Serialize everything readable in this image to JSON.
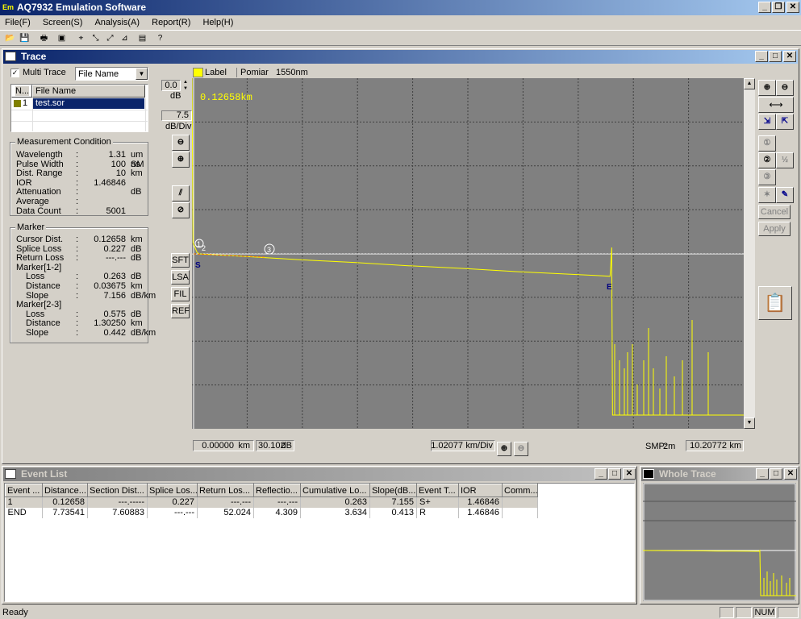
{
  "app": {
    "title": "AQ7932 Emulation Software",
    "icon_text": "Em",
    "window_buttons": {
      "minimize": "_",
      "restore": "❐",
      "close": "✕"
    }
  },
  "menu": [
    "File(F)",
    "Screen(S)",
    "Analysis(A)",
    "Report(R)",
    "Help(H)"
  ],
  "toolbar_icons": [
    "open-icon",
    "save-icon",
    "print-icon",
    "screen-icon",
    "marker-icon",
    "trace-icon",
    "analysis-icon",
    "event-icon",
    "report-icon",
    "help-icon"
  ],
  "trace": {
    "title": "Trace",
    "multi_trace_label": "Multi Trace",
    "multi_trace_checked": true,
    "file_name_select": "File Name",
    "file_table": {
      "headers": [
        "N...",
        "File Name"
      ],
      "rows": [
        {
          "n": "1",
          "name": "test.sor"
        }
      ]
    },
    "measurement": {
      "title": "Measurement Condition",
      "rows": [
        {
          "key": "Wavelength",
          "value": "1.31",
          "unit": "um SM"
        },
        {
          "key": "Pulse Width",
          "value": "100",
          "unit": "ns"
        },
        {
          "key": "Dist. Range",
          "value": "10",
          "unit": "km"
        },
        {
          "key": "IOR",
          "value": "1.46846",
          "unit": ""
        },
        {
          "key": "Attenuation",
          "value": "",
          "unit": "dB"
        },
        {
          "key": "Average",
          "value": "",
          "unit": ""
        },
        {
          "key": "Data Count",
          "value": "5001",
          "unit": ""
        }
      ]
    },
    "marker": {
      "title": "Marker",
      "rows": [
        {
          "key": "Cursor Dist.",
          "value": "0.12658",
          "unit": "km",
          "indent": false
        },
        {
          "key": "Splice Loss",
          "value": "0.227",
          "unit": "dB",
          "indent": false
        },
        {
          "key": "Return Loss",
          "value": "---.---",
          "unit": "dB",
          "indent": false
        },
        {
          "key": "Marker[1-2]",
          "value": "",
          "unit": "",
          "indent": false,
          "heading": true
        },
        {
          "key": "Loss",
          "value": "0.263",
          "unit": "dB",
          "indent": true
        },
        {
          "key": "Distance",
          "value": "0.03675",
          "unit": "km",
          "indent": true
        },
        {
          "key": "Slope",
          "value": "7.156",
          "unit": "dB/km",
          "indent": true
        },
        {
          "key": "Marker[2-3]",
          "value": "",
          "unit": "",
          "indent": false,
          "heading": true
        },
        {
          "key": "Loss",
          "value": "0.575",
          "unit": "dB",
          "indent": true
        },
        {
          "key": "Distance",
          "value": "1.30250",
          "unit": "km",
          "indent": true
        },
        {
          "key": "Slope",
          "value": "0.442",
          "unit": "dB/km",
          "indent": true
        }
      ]
    },
    "vscale": {
      "offset": "0.0",
      "offset_unit": "dB",
      "div": "7.5",
      "div_unit": "dB/Div"
    },
    "side_buttons": [
      "SFT",
      "LSA",
      "FIL",
      "REF"
    ],
    "label_bar": {
      "label": "Label",
      "text": "Pomiar   1550nm",
      "color": "#ffff00"
    },
    "cursor_readout": "0.12658km",
    "bottom_bar": {
      "start": "0.00000",
      "start_unit": "km",
      "level": "30.102",
      "level_unit": "dB",
      "hscale": "1.02077",
      "hscale_unit": "km/Div",
      "smp_label": "SMP:",
      "smp": "2m",
      "end": "10.20772",
      "end_unit": "km"
    },
    "right_text_buttons": [
      "Cancel",
      "Apply"
    ],
    "markers_on_chart": [
      "1",
      "2",
      "3",
      "S",
      "E"
    ]
  },
  "chart_data": {
    "type": "line",
    "x_unit": "km",
    "y_unit": "dB",
    "xlim": [
      0.0,
      10.20772
    ],
    "ylim_top": 30.102,
    "y_div": 7.5,
    "x_div": 1.02077,
    "series": [
      {
        "color": "#ffff00",
        "x": [
          0.0,
          0.02,
          0.09,
          0.13,
          1.0,
          2.0,
          3.0,
          4.0,
          5.0,
          6.0,
          7.0,
          7.5,
          7.73541,
          7.74,
          7.76
        ],
        "y": [
          0.0,
          25.0,
          26.4,
          26.7,
          27.1,
          27.6,
          28.0,
          28.5,
          28.9,
          29.4,
          29.8,
          30.0,
          30.1,
          15.0,
          60.0
        ]
      }
    ],
    "horizontal_line_level": 26.7,
    "grid": true
  },
  "event_list": {
    "title": "Event List",
    "headers": [
      "Event ...",
      "Distance...",
      "Section Dist...",
      "Splice Los...",
      "Return Los...",
      "Reflectio...",
      "Cumulative Lo...",
      "Slope(dB...",
      "Event T...",
      "IOR",
      "Comm..."
    ],
    "rows": [
      [
        "1",
        "0.12658",
        "---.-----",
        "0.227",
        "---.---",
        "---.---",
        "0.263",
        "7.155",
        "S+",
        "1.46846",
        ""
      ],
      [
        "END",
        "7.73541",
        "7.60883",
        "---.---",
        "52.024",
        "4.309",
        "3.634",
        "0.413",
        "R",
        "1.46846",
        ""
      ]
    ]
  },
  "whole_trace": {
    "title": "Whole Trace"
  },
  "status": {
    "text": "Ready",
    "num": "NUM"
  }
}
